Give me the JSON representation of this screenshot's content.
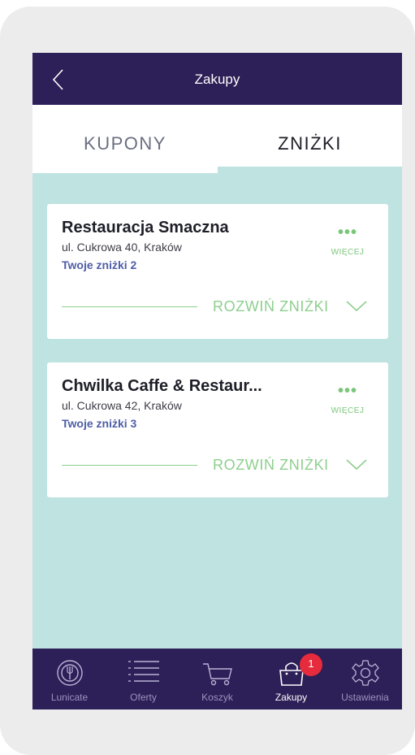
{
  "header": {
    "title": "Zakupy"
  },
  "tabs": [
    {
      "label": "KUPONY",
      "active": false
    },
    {
      "label": "ZNIŻKI",
      "active": true
    }
  ],
  "restaurants": [
    {
      "name": "Restauracja Smaczna",
      "address": "ul. Cukrowa 40, Kraków",
      "discounts": "Twoje zniżki 2",
      "more_dots": "•••",
      "more_label": "WIĘCEJ",
      "expand_label": "ROZWIŃ ZNIŻKI"
    },
    {
      "name": "Chwilka Caffe & Restaur...",
      "address": "ul. Cukrowa 42, Kraków",
      "discounts": "Twoje zniżki 3",
      "more_dots": "•••",
      "more_label": "WIĘCEJ",
      "expand_label": "ROZWIŃ ZNIŻKI"
    }
  ],
  "bottom_nav": [
    {
      "label": "Lunicate",
      "icon": "plate-cutlery-icon",
      "active": false
    },
    {
      "label": "Oferty",
      "icon": "list-icon",
      "active": false
    },
    {
      "label": "Koszyk",
      "icon": "cart-icon",
      "active": false
    },
    {
      "label": "Zakupy",
      "icon": "shopping-bag-icon",
      "active": true,
      "badge": "1"
    },
    {
      "label": "Ustawienia",
      "icon": "gear-icon",
      "active": false
    }
  ],
  "colors": {
    "header_bg": "#2d1f57",
    "content_bg": "#bfe3e1",
    "accent_green": "#7bc67b",
    "link_blue": "#4e5ea6",
    "badge_red": "#e62b3c"
  }
}
